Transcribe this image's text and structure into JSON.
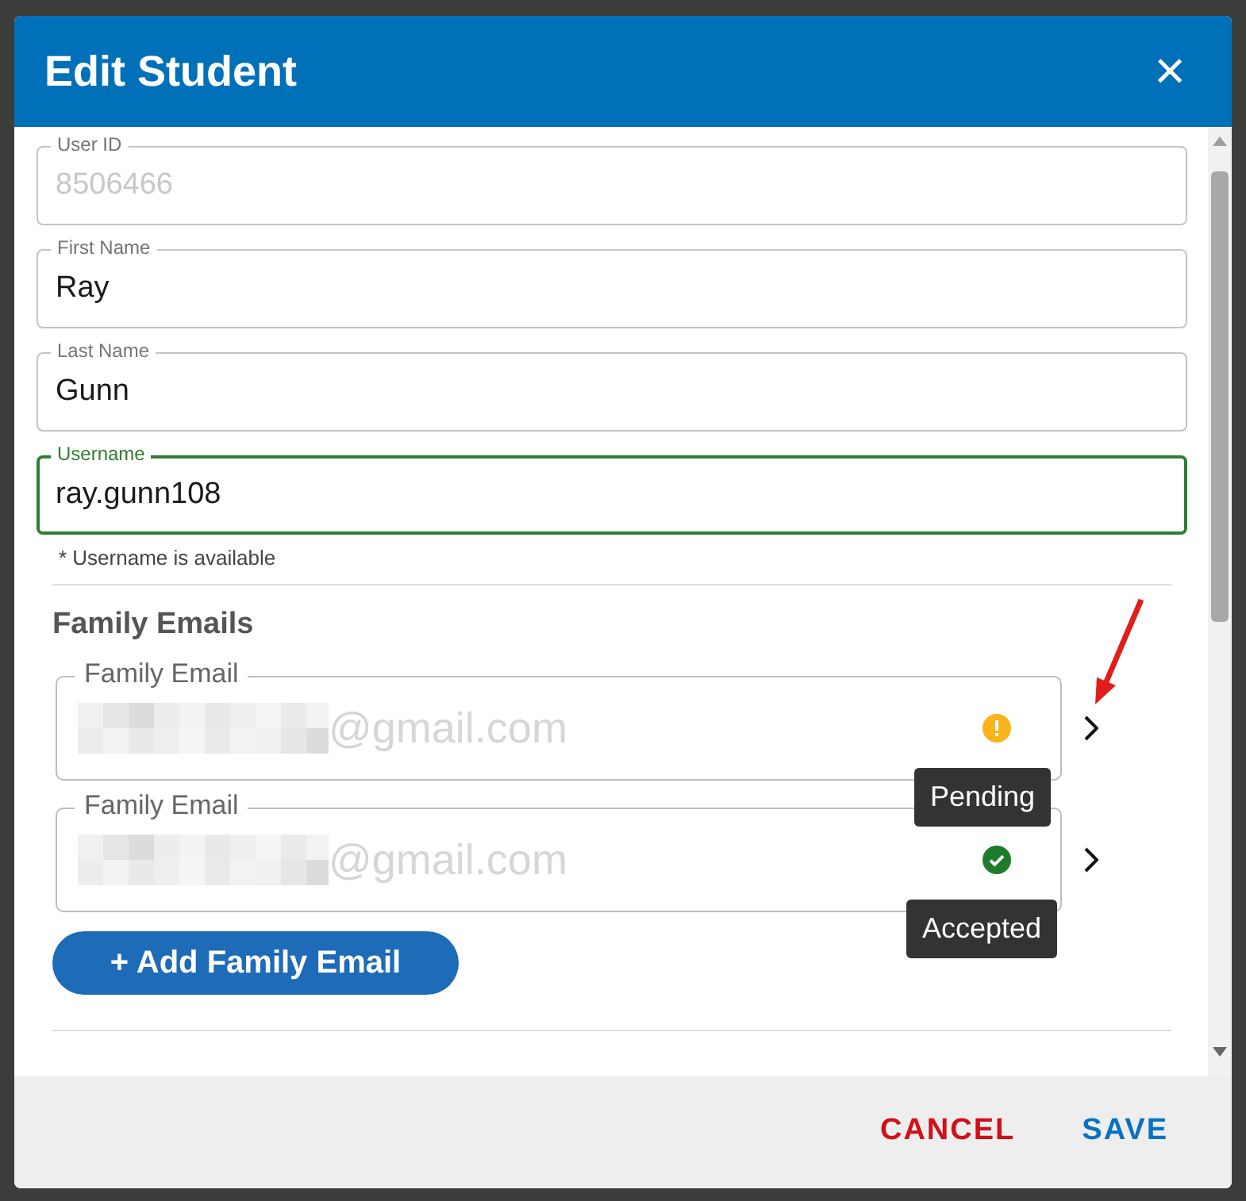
{
  "dialog": {
    "title": "Edit Student",
    "close_icon": "×"
  },
  "fields": [
    {
      "label": "User ID",
      "value": "8506466",
      "disabled": true,
      "focused": false
    },
    {
      "label": "First Name",
      "value": "Ray",
      "disabled": false,
      "focused": false
    },
    {
      "label": "Last Name",
      "value": "Gunn",
      "disabled": false,
      "focused": false
    },
    {
      "label": "Username",
      "value": "ray.gunn108",
      "disabled": false,
      "focused": true
    }
  ],
  "helper_text": "* Username is available",
  "family_emails": {
    "heading": "Family Emails",
    "items": [
      {
        "label": "Family Email",
        "value": "@gmail.com",
        "kind": "pending",
        "tooltip": "Pending"
      },
      {
        "label": "Family Email",
        "value": "@gmail.com",
        "kind": "accepted",
        "tooltip": "Accepted"
      }
    ],
    "add_button": "+ Add Family Email"
  },
  "footer": {
    "buttons": [
      {
        "label": "CANCEL",
        "kind": "cancel"
      },
      {
        "label": "SAVE",
        "kind": "save"
      }
    ]
  }
}
